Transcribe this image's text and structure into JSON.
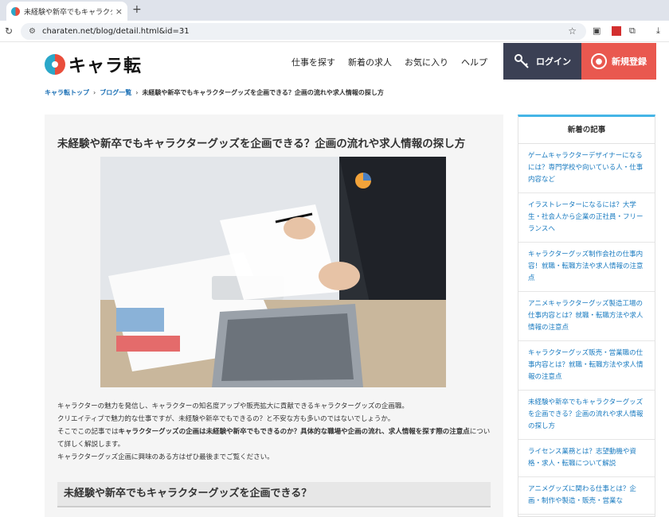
{
  "browser": {
    "tab_title": "未経験や新卒でもキャラクターグ",
    "tab_close": "×",
    "new_tab": "+",
    "url": "charaten.net/blog/detail.html&id=31"
  },
  "header": {
    "logo_text": "キャラ転",
    "nav": [
      "仕事を探す",
      "新着の求人",
      "お気に入り",
      "ヘルプ"
    ],
    "login_label": "ログイン",
    "register_label": "新規登録"
  },
  "breadcrumb": {
    "home": "キャラ転トップ",
    "blog": "ブログ一覧",
    "current": "未経験や新卒でもキャラクターグッズを企画できる？企画の流れや求人情報の探し方"
  },
  "article": {
    "title": "未経験や新卒でもキャラクターグッズを企画できる？企画の流れや求人情報の探し方",
    "intro_1": "キャラクターの魅力を発信し、キャラクターの知名度アップや販売拡大に貢献できるキャラクターグッズの企画職。",
    "intro_2": "クリエイティブで魅力的な仕事ですが、未経験や新卒でもできるの？と不安な方も多いのではないでしょうか。",
    "intro_3_pre": "そこでこの記事では",
    "intro_3_bold": "キャラクターグッズの企画は未経験や新卒でもできるのか？具体的な職場や企画の流れ、求人情報を探す際の注意点",
    "intro_3_post": "について詳しく解説します。",
    "intro_4": "キャラクターグッズ企画に興味のある方はぜひ最後までご覧ください。",
    "h2": "未経験や新卒でもキャラクターグッズを企画できる？"
  },
  "sidebar": {
    "heading": "新着の記事",
    "items": [
      "ゲームキャラクターデザイナーになるには？専門学校や向いている人・仕事内容など",
      "イラストレーターになるには？大学生・社会人から企業の正社員・フリーランスへ",
      "キャラクターグッズ制作会社の仕事内容！就職・転職方法や求人情報の注意点",
      "アニメキャラクターグッズ製造工場の仕事内容とは？就職・転職方法や求人情報の注意点",
      "キャラクターグッズ販売・営業職の仕事内容とは？就職・転職方法や求人情報の注意点",
      "未経験や新卒でもキャラクターグッズを企画できる？企画の流れや求人情報の探し方",
      "ライセンス業務とは？志望動機や資格・求人・転職について解説",
      "アニメグッズに関わる仕事とは？企画・制作や製造・販売・営業な"
    ]
  }
}
